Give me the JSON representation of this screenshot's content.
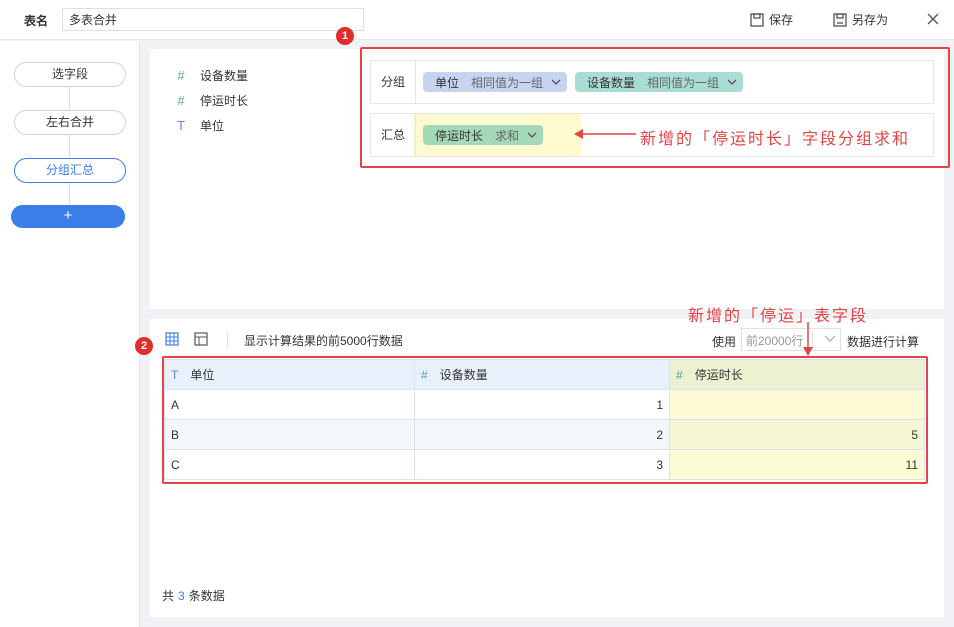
{
  "header": {
    "name_label": "表名",
    "name_value": "多表合并",
    "save_label": "保存",
    "save_as_label": "另存为"
  },
  "steps": [
    {
      "label": "选字段"
    },
    {
      "label": "左右合并"
    },
    {
      "label": "分组汇总"
    }
  ],
  "add_step_label": "+",
  "fields": [
    {
      "icon": "#",
      "name": "设备数量"
    },
    {
      "icon": "#",
      "name": "停运时长"
    },
    {
      "icon": "T",
      "name": "单位"
    }
  ],
  "group_row": {
    "label": "分组",
    "chips": [
      {
        "name": "单位",
        "mode": "相同值为一组"
      },
      {
        "name": "设备数量",
        "mode": "相同值为一组"
      }
    ]
  },
  "summary_row": {
    "label": "汇总",
    "chips": [
      {
        "name": "停运时长",
        "mode": "求和"
      }
    ]
  },
  "annotations": {
    "badge1": "1",
    "badge2": "2",
    "note1": "新增的「停运时长」字段分组求和",
    "note2": "新增的「停运」表字段"
  },
  "preview": {
    "note": "显示计算结果的前5000行数据",
    "use_label": "使用",
    "rows_placeholder": "前20000行",
    "calc_label": "数据进行计算",
    "columns": [
      {
        "icon": "T",
        "name": "单位"
      },
      {
        "icon": "#",
        "name": "设备数量"
      },
      {
        "icon": "#",
        "name": "停运时长"
      }
    ],
    "rows": [
      [
        "A",
        "1",
        ""
      ],
      [
        "B",
        "2",
        "5"
      ],
      [
        "C",
        "3",
        "11"
      ]
    ],
    "total_prefix": "共",
    "total_count": "3",
    "total_suffix": "条数据"
  },
  "colors": {
    "accent": "#3b7ee8",
    "annotation_red": "#e34545",
    "highlight_yellow": "#fdfad0"
  }
}
